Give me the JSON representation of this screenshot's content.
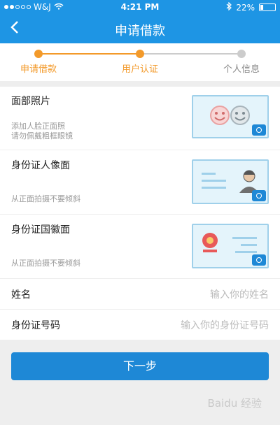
{
  "status": {
    "carrier": "W&J",
    "time": "4:21 PM",
    "battery": "22%",
    "battery_level": 0.22
  },
  "nav": {
    "title": "申请借款",
    "back_icon": "chevron-left-icon"
  },
  "steps": [
    {
      "label": "申请借款",
      "state": "done"
    },
    {
      "label": "用户认证",
      "state": "current"
    },
    {
      "label": "个人信息",
      "state": "todo"
    }
  ],
  "colors": {
    "primary": "#1e95e4",
    "accent": "#f39a2a",
    "inactive": "#cccccc"
  },
  "photo_rows": [
    {
      "label": "面部照片",
      "hints": [
        "添加人脸正面照",
        "请勿佩戴粗框眼镜"
      ]
    },
    {
      "label": "身份证人像面",
      "hints": [
        "从正面拍摄不要倾斜"
      ]
    },
    {
      "label": "身份证国徽面",
      "hints": [
        "从正面拍摄不要倾斜"
      ]
    }
  ],
  "fields": [
    {
      "label": "姓名",
      "placeholder": "输入你的姓名"
    },
    {
      "label": "身份证号码",
      "placeholder": "输入你的身份证号码"
    }
  ],
  "next_button": "下一步",
  "watermark": "Baidu 经验"
}
